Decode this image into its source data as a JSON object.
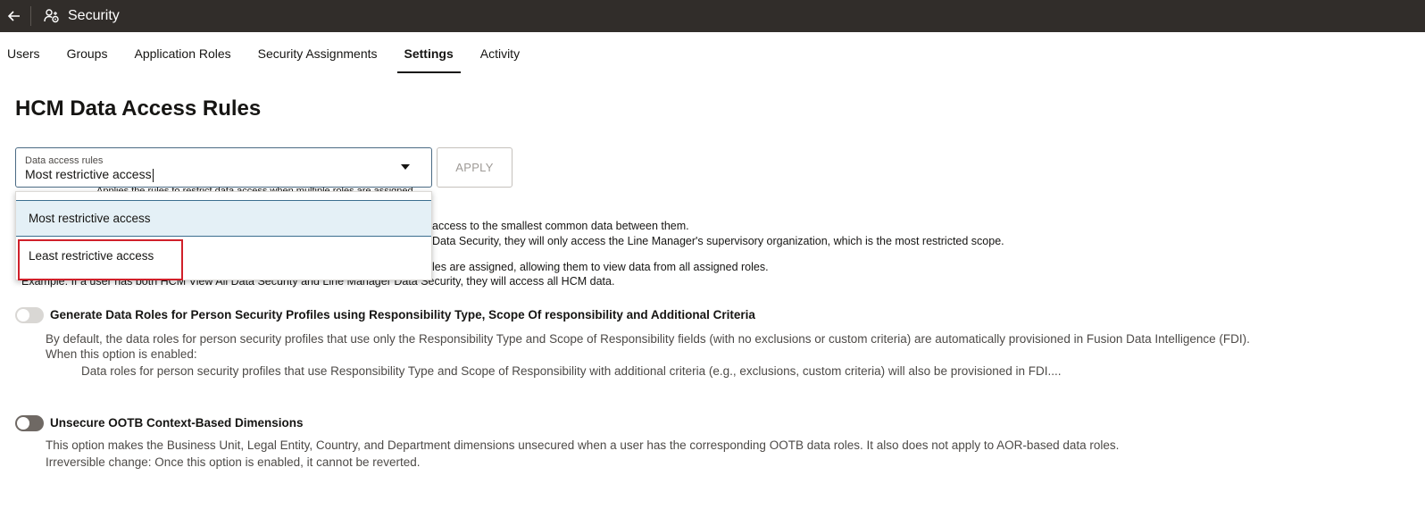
{
  "header": {
    "back_icon": "back-arrow-icon",
    "app_icon": "users-security-icon",
    "title": "Security"
  },
  "tabs": [
    {
      "label": "Users",
      "active": false
    },
    {
      "label": "Groups",
      "active": false
    },
    {
      "label": "Application Roles",
      "active": false
    },
    {
      "label": "Security Assignments",
      "active": false
    },
    {
      "label": "Settings",
      "active": true
    },
    {
      "label": "Activity",
      "active": false
    }
  ],
  "page": {
    "title": "HCM Data Access Rules"
  },
  "data_access": {
    "field_label": "Data access rules",
    "value": "Most restrictive access",
    "apply_label": "APPLY",
    "options": [
      "Most restrictive access",
      "Least restrictive access"
    ]
  },
  "description": {
    "line_top_fragment": "Applies the rules to restrict data access when multiple roles are assigned.",
    "line1": "access to the smallest common data between them.",
    "line2": "Data Security, they will only access the Line Manager's supervisory organization, which is the most restricted scope.",
    "line3": "les are assigned, allowing them to view data from all assigned roles.",
    "line4": "Example:  If a user has both HCM View All Data Security and Line Manager Data Security, they will access all HCM data."
  },
  "option1": {
    "title": "Generate Data Roles for Person Security Profiles using Responsibility Type, Scope Of responsibility and Additional Criteria",
    "text1": "By default, the data roles for person security profiles that use only the Responsibility Type and Scope of Responsibility fields (with no exclusions or custom criteria) are automatically provisioned in Fusion Data Intelligence (FDI).",
    "text2": "When this option is enabled:",
    "text3": "Data roles for person security profiles that use Responsibility Type and Scope of Responsibility with additional criteria (e.g., exclusions, custom criteria) will also be provisioned in FDI....",
    "toggle_state": "disabled"
  },
  "option2": {
    "title": "Unsecure OOTB Context-Based Dimensions",
    "text1": "This option makes the Business Unit, Legal Entity, Country, and Department dimensions unsecured when a user has the corresponding OOTB data roles. It also does not apply to AOR-based data roles.",
    "text2": "Irreversible change: Once this option is enabled, it cannot be reverted.",
    "toggle_state": "off"
  },
  "colors": {
    "topbar": "#312d2a",
    "highlight": "#d0202a",
    "selected_option_bg": "#e4f0f6"
  }
}
